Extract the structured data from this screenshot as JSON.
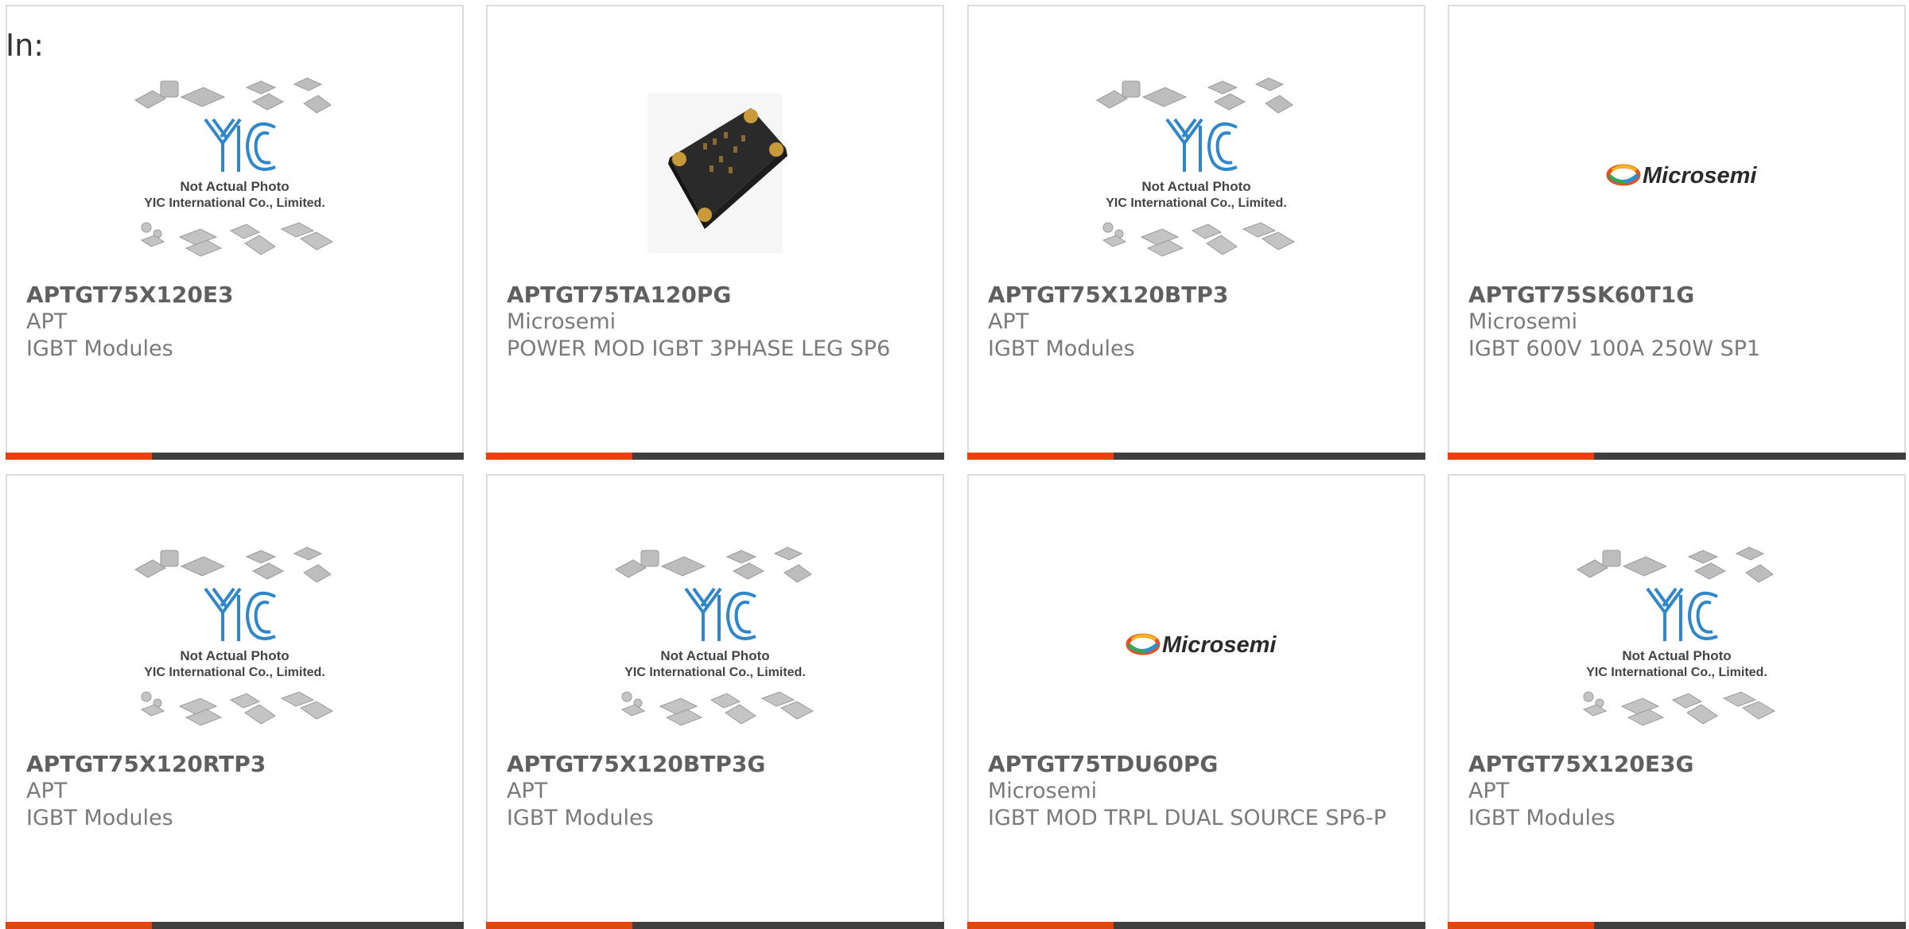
{
  "header": {
    "label": "In:"
  },
  "colors": {
    "accent": "#e8420f",
    "bar": "#3f3f3f",
    "border": "#dcdcdc"
  },
  "products": [
    {
      "part": "APTGT75X120E3",
      "maker": "APT",
      "desc": "IGBT Modules",
      "image": "yic-placeholder"
    },
    {
      "part": "APTGT75TA120PG",
      "maker": "Microsemi",
      "desc": "POWER MOD IGBT 3PHASE LEG SP6",
      "image": "module-photo"
    },
    {
      "part": "APTGT75X120BTP3",
      "maker": "APT",
      "desc": "IGBT Modules",
      "image": "yic-placeholder"
    },
    {
      "part": "APTGT75SK60T1G",
      "maker": "Microsemi",
      "desc": "IGBT 600V 100A 250W SP1",
      "image": "microsemi-logo"
    },
    {
      "part": "APTGT75X120RTP3",
      "maker": "APT",
      "desc": "IGBT Modules",
      "image": "yic-placeholder"
    },
    {
      "part": "APTGT75X120BTP3G",
      "maker": "APT",
      "desc": "IGBT Modules",
      "image": "yic-placeholder"
    },
    {
      "part": "APTGT75TDU60PG",
      "maker": "Microsemi",
      "desc": "IGBT MOD TRPL DUAL SOURCE SP6-P",
      "image": "microsemi-logo"
    },
    {
      "part": "APTGT75X120E3G",
      "maker": "APT",
      "desc": "IGBT Modules",
      "image": "yic-placeholder"
    }
  ],
  "placeholder": {
    "line1": "Not Actual Photo",
    "line2": "YIC International Co., Limited.",
    "brand": "YIC"
  },
  "logo": {
    "text": "Microsemi"
  }
}
